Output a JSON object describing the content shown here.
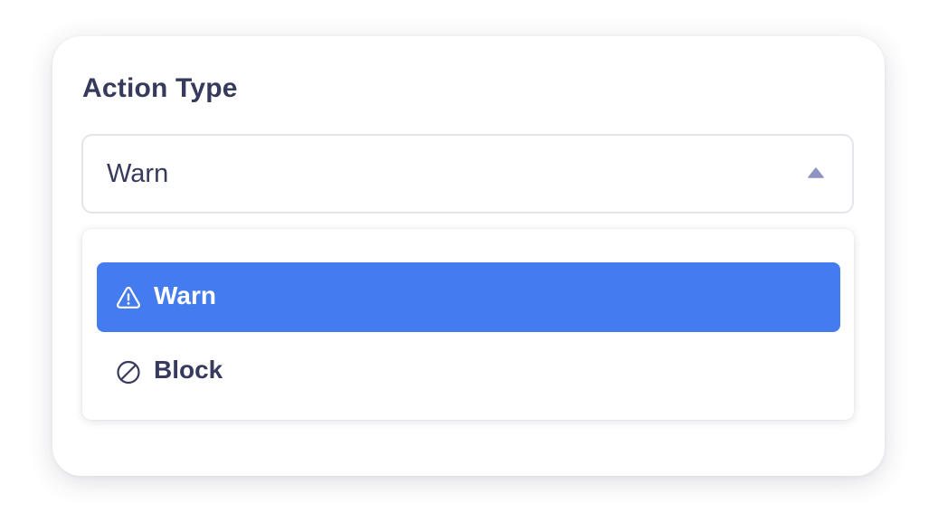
{
  "field": {
    "label": "Action Type",
    "selected_value": "Warn"
  },
  "dropdown": {
    "options": [
      {
        "label": "Warn",
        "icon": "warning-triangle-icon",
        "selected": true
      },
      {
        "label": "Block",
        "icon": "block-icon",
        "selected": false
      }
    ]
  },
  "colors": {
    "accent": "#447bee",
    "text": "#363a5c",
    "caret": "#8f93c4",
    "border": "#e3e5ea"
  }
}
